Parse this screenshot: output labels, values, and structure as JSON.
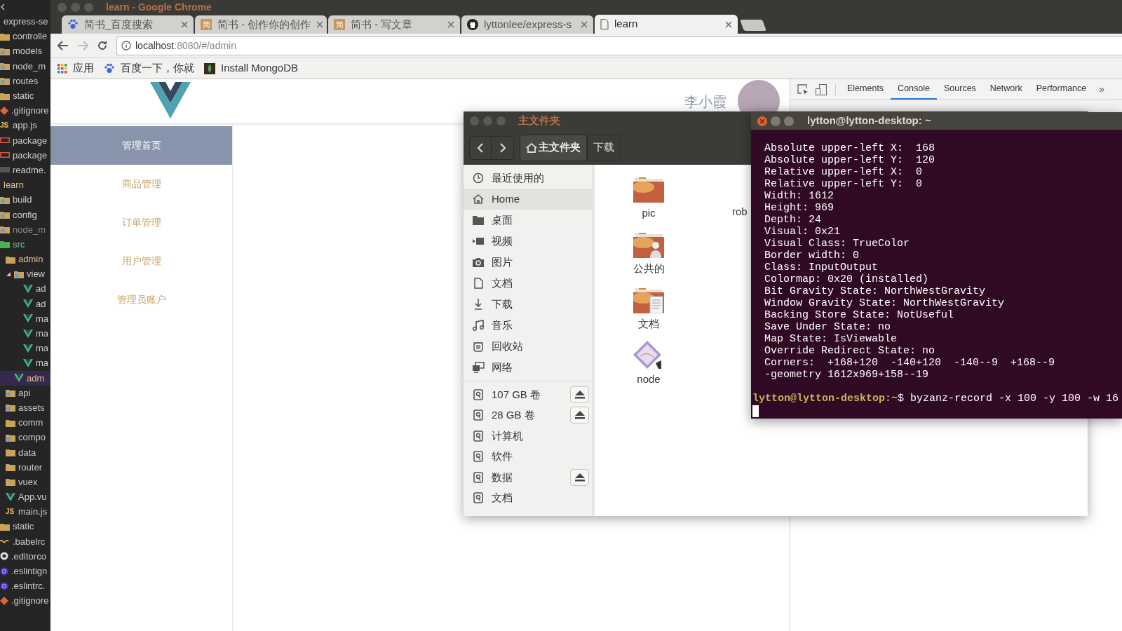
{
  "editor_tree": {
    "items": [
      {
        "label": "express-se",
        "color": "#cccccc",
        "selected": false,
        "children": [
          {
            "label": "controlle",
            "kind": "folder",
            "color": "#cccccc",
            "selected": false
          },
          {
            "label": "models",
            "kind": "folder-special",
            "color": "#cccccc",
            "selected": false
          },
          {
            "label": "node_m",
            "kind": "folder-special",
            "color": "#cccccc",
            "selected": false
          },
          {
            "label": "routes",
            "kind": "folder-special",
            "color": "#cccccc",
            "selected": false
          },
          {
            "label": "static",
            "kind": "folder",
            "color": "#cccccc",
            "selected": false
          },
          {
            "label": ".gitignore",
            "kind": "git",
            "color": "#cccccc",
            "selected": false
          },
          {
            "label": "app.js",
            "kind": "js",
            "icon_text": "JS",
            "color": "#cccccc",
            "selected": false
          },
          {
            "label": "package",
            "kind": "npm",
            "color": "#cccccc",
            "selected": false
          },
          {
            "label": "package",
            "kind": "npm",
            "color": "#cccccc",
            "selected": false
          },
          {
            "label": "readme.",
            "kind": "markdown",
            "color": "#cccccc",
            "selected": false
          }
        ]
      },
      {
        "label": "learn",
        "color": "#e2c08d",
        "selected": false,
        "children": [
          {
            "label": "build",
            "kind": "folder-special",
            "color": "#cccccc",
            "selected": false
          },
          {
            "label": "config",
            "kind": "folder-special",
            "color": "#cccccc",
            "selected": false
          },
          {
            "label": "node_m",
            "kind": "folder-special",
            "color": "#8a8a8a",
            "selected": false
          },
          {
            "label": "src",
            "kind": "folder-src",
            "color": "#73c991",
            "selected": false,
            "children": [
              {
                "label": "admin",
                "kind": "folder",
                "color": "#e2c08d",
                "selected": false,
                "children": [
                  {
                    "label": "view",
                    "kind": "folder-special",
                    "expanded": true,
                    "color": "#cccccc",
                    "selected": false,
                    "children": [
                      {
                        "label": "ad",
                        "kind": "vue",
                        "color": "#cccccc",
                        "selected": false
                      },
                      {
                        "label": "ad",
                        "kind": "vue",
                        "color": "#cccccc",
                        "selected": false
                      },
                      {
                        "label": "ma",
                        "kind": "vue",
                        "color": "#cccccc",
                        "selected": false
                      },
                      {
                        "label": "ma",
                        "kind": "vue",
                        "color": "#cccccc",
                        "selected": false
                      },
                      {
                        "label": "ma",
                        "kind": "vue",
                        "color": "#cccccc",
                        "selected": false
                      },
                      {
                        "label": "ma",
                        "kind": "vue",
                        "color": "#cccccc",
                        "selected": false
                      }
                    ]
                  },
                  {
                    "label": "adm",
                    "kind": "vue",
                    "color": "#e2c08d",
                    "selected": true
                  }
                ]
              },
              {
                "label": "api",
                "kind": "folder-special",
                "color": "#cccccc",
                "selected": false
              },
              {
                "label": "assets",
                "kind": "folder-special",
                "color": "#cccccc",
                "selected": false
              },
              {
                "label": "comm",
                "kind": "folder",
                "color": "#cccccc",
                "selected": false
              },
              {
                "label": "compo",
                "kind": "folder-special",
                "color": "#cccccc",
                "selected": false
              },
              {
                "label": "data",
                "kind": "folder",
                "color": "#cccccc",
                "selected": false
              },
              {
                "label": "router",
                "kind": "folder",
                "color": "#cccccc",
                "selected": false
              },
              {
                "label": "vuex",
                "kind": "folder",
                "color": "#cccccc",
                "selected": false
              },
              {
                "label": "App.vu",
                "kind": "vue",
                "color": "#cccccc",
                "selected": false
              },
              {
                "label": "main.js",
                "kind": "js",
                "icon_text": "JS",
                "color": "#cccccc",
                "selected": false
              }
            ]
          },
          {
            "label": "static",
            "kind": "folder",
            "color": "#cccccc",
            "selected": false
          },
          {
            "label": ".babelrc",
            "kind": "babel",
            "color": "#cccccc",
            "selected": false
          },
          {
            "label": ".editorco",
            "kind": "editorconfig",
            "color": "#cccccc",
            "selected": false
          },
          {
            "label": ".eslintign",
            "kind": "eslint",
            "color": "#cccccc",
            "selected": false
          },
          {
            "label": ".eslintrc.",
            "kind": "eslint",
            "color": "#cccccc",
            "selected": false
          },
          {
            "label": ".gitignore",
            "kind": "git",
            "color": "#cccccc",
            "selected": false
          }
        ]
      }
    ]
  },
  "browser": {
    "title": "learn - Google Chrome",
    "tabs": [
      {
        "label": "简书_百度搜索",
        "kind": "paw",
        "selected": false
      },
      {
        "label": "简书 - 创作你的创作",
        "kind": "letter",
        "favicon_text": "简",
        "selected": false
      },
      {
        "label": "简书 - 写文章",
        "kind": "letter",
        "favicon_text": "简",
        "selected": false
      },
      {
        "label": "lyttonlee/express-s",
        "kind": "github",
        "selected": false
      },
      {
        "label": "learn",
        "kind": "page",
        "selected": true
      }
    ],
    "address": {
      "host": "localhost",
      "path": ":8080/#/admin"
    },
    "bookmarks": [
      {
        "label": "应用",
        "kind": "apps"
      },
      {
        "label": "百度一下，你就",
        "kind": "paw"
      },
      {
        "label": "Install MongoDB",
        "kind": "leaf"
      }
    ]
  },
  "page": {
    "menu": [
      {
        "label": "管理首页",
        "selected": true
      },
      {
        "label": "商品管理",
        "selected": false
      },
      {
        "label": "订单管理",
        "selected": false
      },
      {
        "label": "用户管理",
        "selected": false
      },
      {
        "label": "管理员账户",
        "selected": false
      }
    ],
    "user_name": "李小霞"
  },
  "devtools": {
    "tabs": [
      {
        "label": "Elements",
        "selected": false
      },
      {
        "label": "Console",
        "selected": true
      },
      {
        "label": "Sources",
        "selected": false
      },
      {
        "label": "Network",
        "selected": false
      },
      {
        "label": "Performance",
        "selected": false
      }
    ],
    "overflow": "»"
  },
  "file_manager": {
    "title": "主文件夹",
    "path": [
      {
        "label": "主文件夹",
        "kind": "home",
        "selected": true
      },
      {
        "label": "下载",
        "kind": "plain",
        "selected": false
      }
    ],
    "places": [
      {
        "label": "最近使用的",
        "kind": "clock",
        "selected": false
      },
      {
        "label": "Home",
        "kind": "home",
        "selected": true
      },
      {
        "label": "桌面",
        "kind": "folder",
        "selected": false
      },
      {
        "label": "视频",
        "kind": "video",
        "selected": false
      },
      {
        "label": "图片",
        "kind": "camera",
        "selected": false
      },
      {
        "label": "文档",
        "kind": "document",
        "selected": false
      },
      {
        "label": "下载",
        "kind": "download",
        "selected": false
      },
      {
        "label": "音乐",
        "kind": "music",
        "selected": false
      },
      {
        "label": "回收站",
        "kind": "trash",
        "selected": false
      },
      {
        "label": "网络",
        "kind": "network",
        "selected": false
      }
    ],
    "devices": [
      {
        "label": "107 GB 卷",
        "eject": true
      },
      {
        "label": "28 GB 卷",
        "eject": true
      },
      {
        "label": "计算机",
        "eject": false
      },
      {
        "label": "软件",
        "eject": false
      },
      {
        "label": "数据",
        "eject": true
      },
      {
        "label": "文档",
        "eject": false
      }
    ],
    "files": [
      {
        "label": "pic",
        "kind": "folder"
      },
      {
        "label": "公共的",
        "kind": "folder-public"
      },
      {
        "label": "文档",
        "kind": "folder-documents"
      },
      {
        "label": "node",
        "kind": "link"
      }
    ],
    "files_column_2": [
      {
        "label": "rob"
      }
    ]
  },
  "terminal": {
    "title": "lytton@lytton-desktop: ~",
    "lines": [
      "Absolute upper-left X:  168",
      "Absolute upper-left Y:  120",
      "Relative upper-left X:  0",
      "Relative upper-left Y:  0",
      "Width: 1612",
      "Height: 969",
      "Depth: 24",
      "Visual: 0x21",
      "Visual Class: TrueColor",
      "Border width: 0",
      "Class: InputOutput",
      "Colormap: 0x20 (installed)",
      "Bit Gravity State: NorthWestGravity",
      "Window Gravity State: NorthWestGravity",
      "Backing Store State: NotUseful",
      "Save Under State: no",
      "Map State: IsViewable",
      "Override Redirect State: no",
      "Corners:  +168+120  -140+120  -140--9  +168--9",
      "-geometry 1612x969+158--19"
    ],
    "prompt": {
      "user_host": "lytton@lytton-desktop:~",
      "command": "$ byzanz-record -x 100 -y 100 -w 16"
    }
  }
}
